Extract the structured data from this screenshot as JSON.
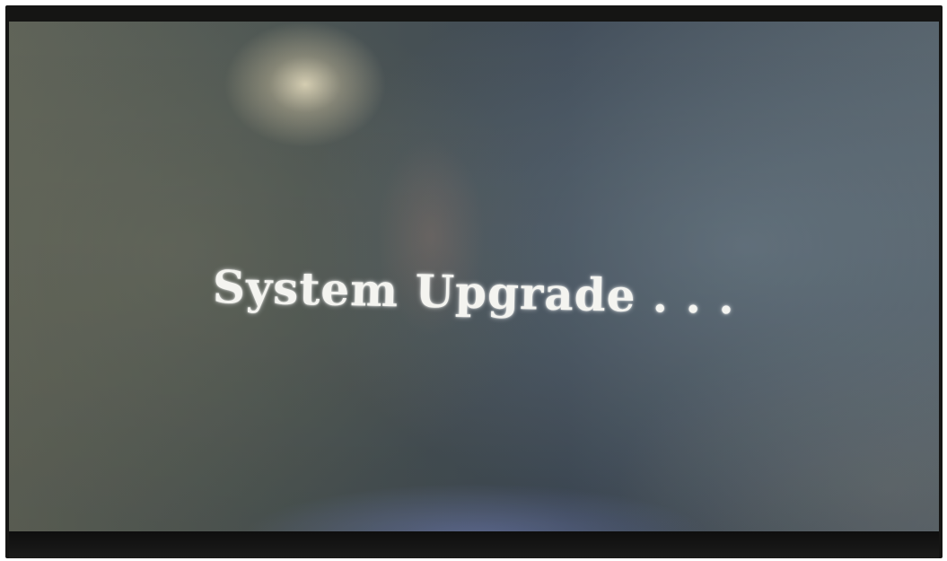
{
  "screen": {
    "message": "System Upgrade . . ."
  }
}
